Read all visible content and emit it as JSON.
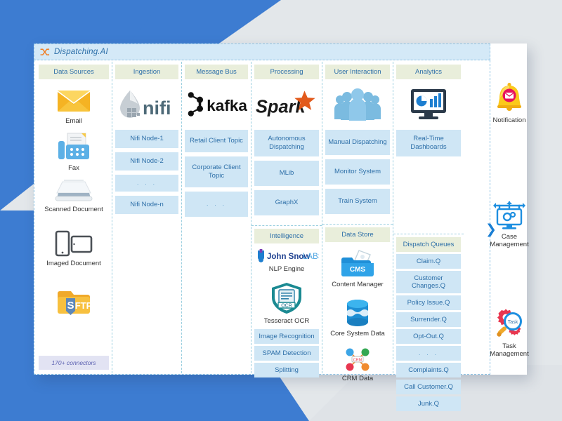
{
  "app": {
    "title": "Dispatching.AI",
    "logo_icon": "shuffle-icon",
    "accent_blue": "#2d6fa8",
    "chip_blue": "#cfe6f5",
    "header_green": "#e9eedb",
    "titlebar_blue": "#d4e9f7",
    "logo_orange": "#f07d22"
  },
  "columns": [
    {
      "id": "data-sources",
      "header": "Data Sources",
      "items": [
        {
          "label": "Email",
          "icon": "email-envelope-icon"
        },
        {
          "label": "Fax",
          "icon": "fax-machine-icon"
        },
        {
          "label": "Scanned Document",
          "icon": "scanner-icon"
        },
        {
          "label": "Imaged Document",
          "icon": "mobile-tablet-icon"
        },
        {
          "label": "SFTP",
          "icon": "sftp-folder-icon"
        }
      ],
      "footer": "170+ connectors"
    },
    {
      "id": "ingestion",
      "header": "Ingestion",
      "logo": "nifi-logo",
      "logo_text": "nifi",
      "chips": [
        "Nifi Node-1",
        "Nifi Node-2",
        ". . .",
        "Nifi Node-n"
      ]
    },
    {
      "id": "message-bus",
      "header": "Message Bus",
      "logo": "kafka-logo",
      "logo_text": "kafka",
      "chips": [
        "Retail Client Topic",
        "Corporate Client Topic",
        ". . ."
      ]
    },
    {
      "id": "processing",
      "header": "Processing",
      "logo": "spark-logo",
      "logo_text": "Spark",
      "chips": [
        "Autonomous Dispatching",
        "MLib",
        "GraphX"
      ]
    },
    {
      "id": "user-interaction",
      "header": "User Interaction",
      "logo": "users-group-icon",
      "chips": [
        "Manual Dispatching",
        "Monitor System",
        "Train System"
      ]
    },
    {
      "id": "analytics",
      "header": "Analytics",
      "logo": "dashboard-monitor-icon",
      "chips": [
        "Real-Time Dashboards"
      ]
    }
  ],
  "lower": {
    "intelligence": {
      "header": "Intelligence",
      "items": [
        {
          "label": "NLP Engine",
          "icon": "john-snow-labs-logo",
          "brand": "John Snow LABS"
        },
        {
          "label": "Tesseract OCR",
          "icon": "tesseract-ocr-icon"
        }
      ],
      "chips": [
        "Image Recognition",
        "SPAM Detection",
        "Splitting"
      ]
    },
    "data_store": {
      "header": "Data Store",
      "items": [
        {
          "label": "Content Manager",
          "icon": "cms-folder-icon"
        },
        {
          "label": "Core System Data",
          "icon": "database-cylinder-icon"
        },
        {
          "label": "CRM Data",
          "icon": "crm-network-icon"
        }
      ]
    },
    "dispatch_queues": {
      "header": "Dispatch Queues",
      "chips": [
        "Claim.Q",
        "Customer Changes.Q",
        "Policy Issue.Q",
        "Surrender.Q",
        "Opt-Out.Q",
        ". . .",
        "Complaints.Q",
        "Call Customer.Q",
        "Junk.Q"
      ]
    }
  },
  "outcomes": [
    {
      "label": "Notification",
      "icon": "bell-mail-icon"
    },
    {
      "label": "Case\nManagement",
      "label_line1": "Case",
      "label_line2": "Management",
      "icon": "case-management-icon"
    },
    {
      "label": "Task\nManagement",
      "label_line1": "Task",
      "label_line2": "Management",
      "icon": "task-management-icon"
    }
  ],
  "flow_arrow": "❯"
}
